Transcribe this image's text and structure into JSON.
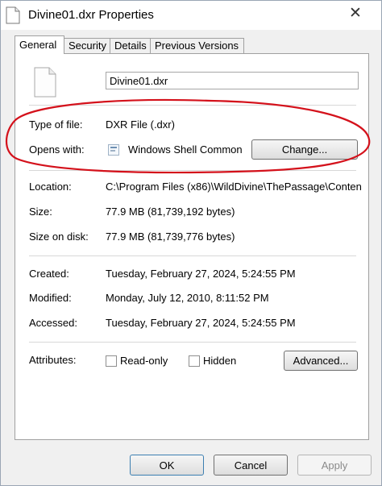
{
  "window": {
    "title": "Divine01.dxr Properties",
    "close_glyph": "✕"
  },
  "tabs": [
    {
      "label": "General",
      "active": true
    },
    {
      "label": "Security"
    },
    {
      "label": "Details"
    },
    {
      "label": "Previous Versions"
    }
  ],
  "general": {
    "file_name": "Divine01.dxr",
    "type_label": "Type of file:",
    "type_value": "DXR File (.dxr)",
    "opens_label": "Opens with:",
    "opens_value": "Windows Shell Common",
    "change_button": "Change...",
    "location_label": "Location:",
    "location_value": "C:\\Program Files (x86)\\WildDivine\\ThePassage\\Conten",
    "size_label": "Size:",
    "size_value": "77.9 MB (81,739,192 bytes)",
    "size_disk_label": "Size on disk:",
    "size_disk_value": "77.9 MB (81,739,776 bytes)",
    "created_label": "Created:",
    "created_value": "Tuesday, February 27, 2024, 5:24:55 PM",
    "modified_label": "Modified:",
    "modified_value": "Monday, July 12, 2010, 8:11:52 PM",
    "accessed_label": "Accessed:",
    "accessed_value": "Tuesday, February 27, 2024, 5:24:55 PM",
    "attributes_label": "Attributes:",
    "readonly_label": "Read-only",
    "hidden_label": "Hidden",
    "advanced_button": "Advanced..."
  },
  "footer": {
    "ok": "OK",
    "cancel": "Cancel",
    "apply": "Apply"
  },
  "colors": {
    "annotation": "#d4111b"
  }
}
